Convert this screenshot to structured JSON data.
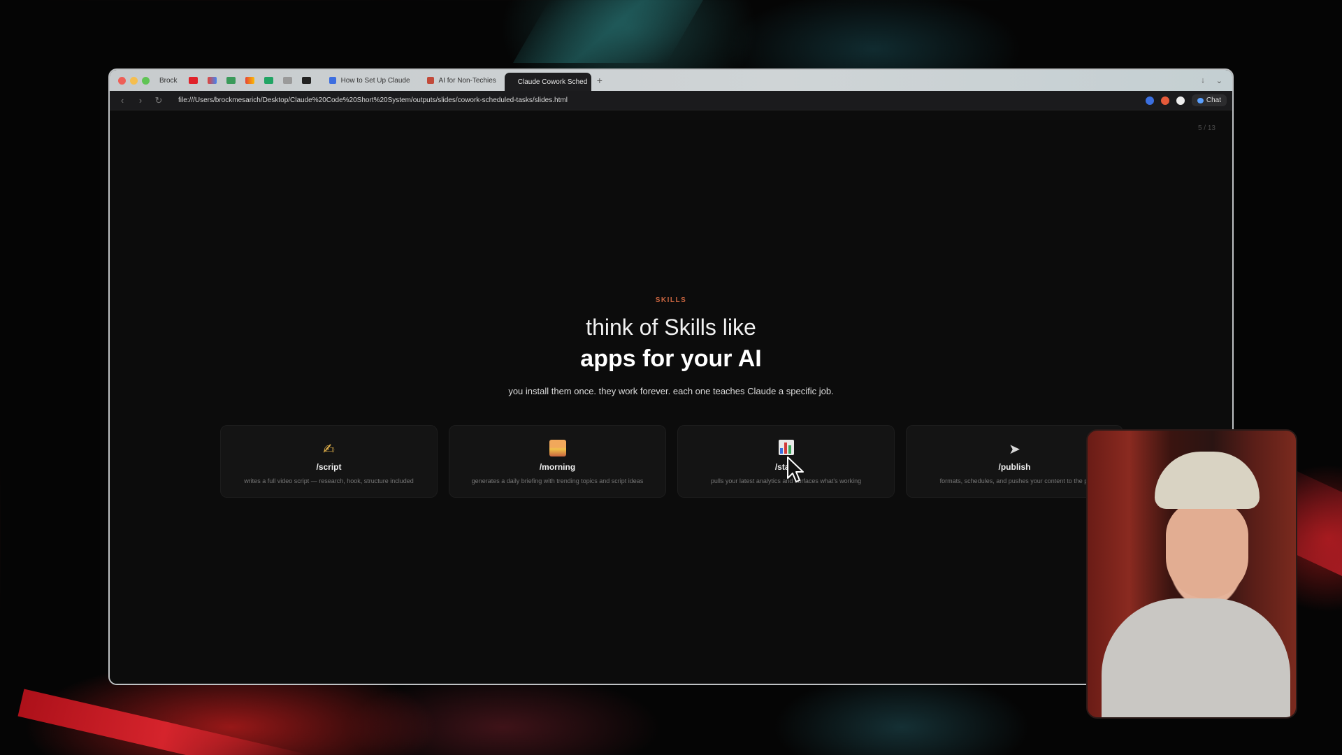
{
  "browser": {
    "tab_bar": {
      "profile_label": "Brock",
      "tabs": [
        {
          "label": "How to Set Up Claude"
        },
        {
          "label": "AI for Non-Techies"
        },
        {
          "label": "Claude Cowork Sched"
        }
      ],
      "new_tab_symbol": "+"
    },
    "address_bar": {
      "url": "file:///Users/brockmesarich/Desktop/Claude%20Code%20Short%20System/outputs/slides/cowork-scheduled-tasks/slides.html",
      "chat_label": "Chat"
    }
  },
  "slide": {
    "counter": "5 / 13",
    "eyebrow": "SKILLS",
    "title_light": "think of Skills like",
    "title_bold": "apps for your AI",
    "subtitle": "you install them once. they work forever. each one teaches Claude a specific job.",
    "cards": [
      {
        "icon": "writing-hand-icon",
        "name": "/script",
        "desc": "writes a full video script — research, hook, structure included"
      },
      {
        "icon": "sunrise-icon",
        "name": "/morning",
        "desc": "generates a daily briefing with trending topics and script ideas"
      },
      {
        "icon": "bar-chart-icon",
        "name": "/stats",
        "desc": "pulls your latest analytics and surfaces what's working"
      },
      {
        "icon": "rocket-icon",
        "name": "/publish",
        "desc": "formats, schedules, and pushes your content to the pl"
      }
    ],
    "pagination": {
      "total": 13,
      "current": 5
    }
  },
  "colors": {
    "accent": "#c7643f",
    "slide_bg": "#0c0c0c"
  }
}
